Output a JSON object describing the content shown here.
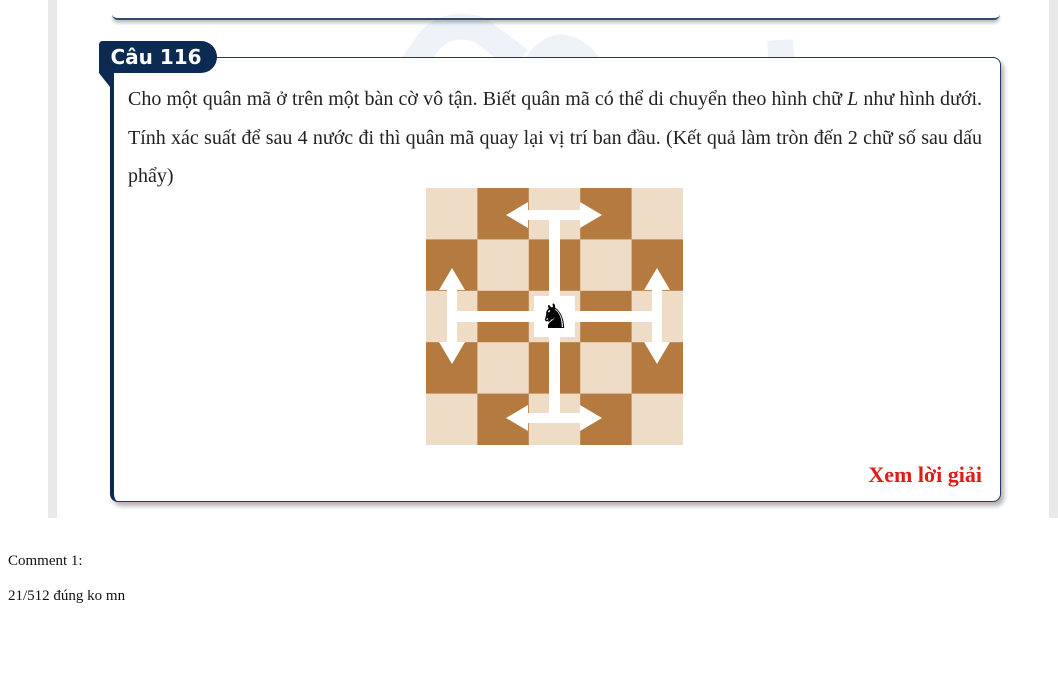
{
  "question": {
    "tab_label": "Câu 116",
    "text_before": "Cho một quân mã ở trên một bàn cờ vô tận. Biết quân mã có thể di chuyển theo hình chữ ",
    "math_letter": "L",
    "text_after": " như hình dưới. Tính xác suất để sau 4 nước đi thì quân mã quay lại vị trí ban đầu. (Kết quả làm tròn đến 2 chữ số sau dấu phẩy)",
    "knight_symbol": "♞",
    "board": {
      "rows": 5,
      "cols": 5,
      "light_color": "#eedcc6",
      "dark_color": "#b47a3f",
      "arrow_color": "#ffffff"
    },
    "solution_link": "Xem lời giải"
  },
  "comments": [
    {
      "label": "Comment 1:",
      "text": "21/512 đúng ko mn"
    }
  ],
  "colors": {
    "accent_navy": "#0d2a52",
    "link_red": "#e11a1a"
  },
  "icons": {
    "knight": "knight-icon",
    "arrows": "double-arrow-icon"
  }
}
